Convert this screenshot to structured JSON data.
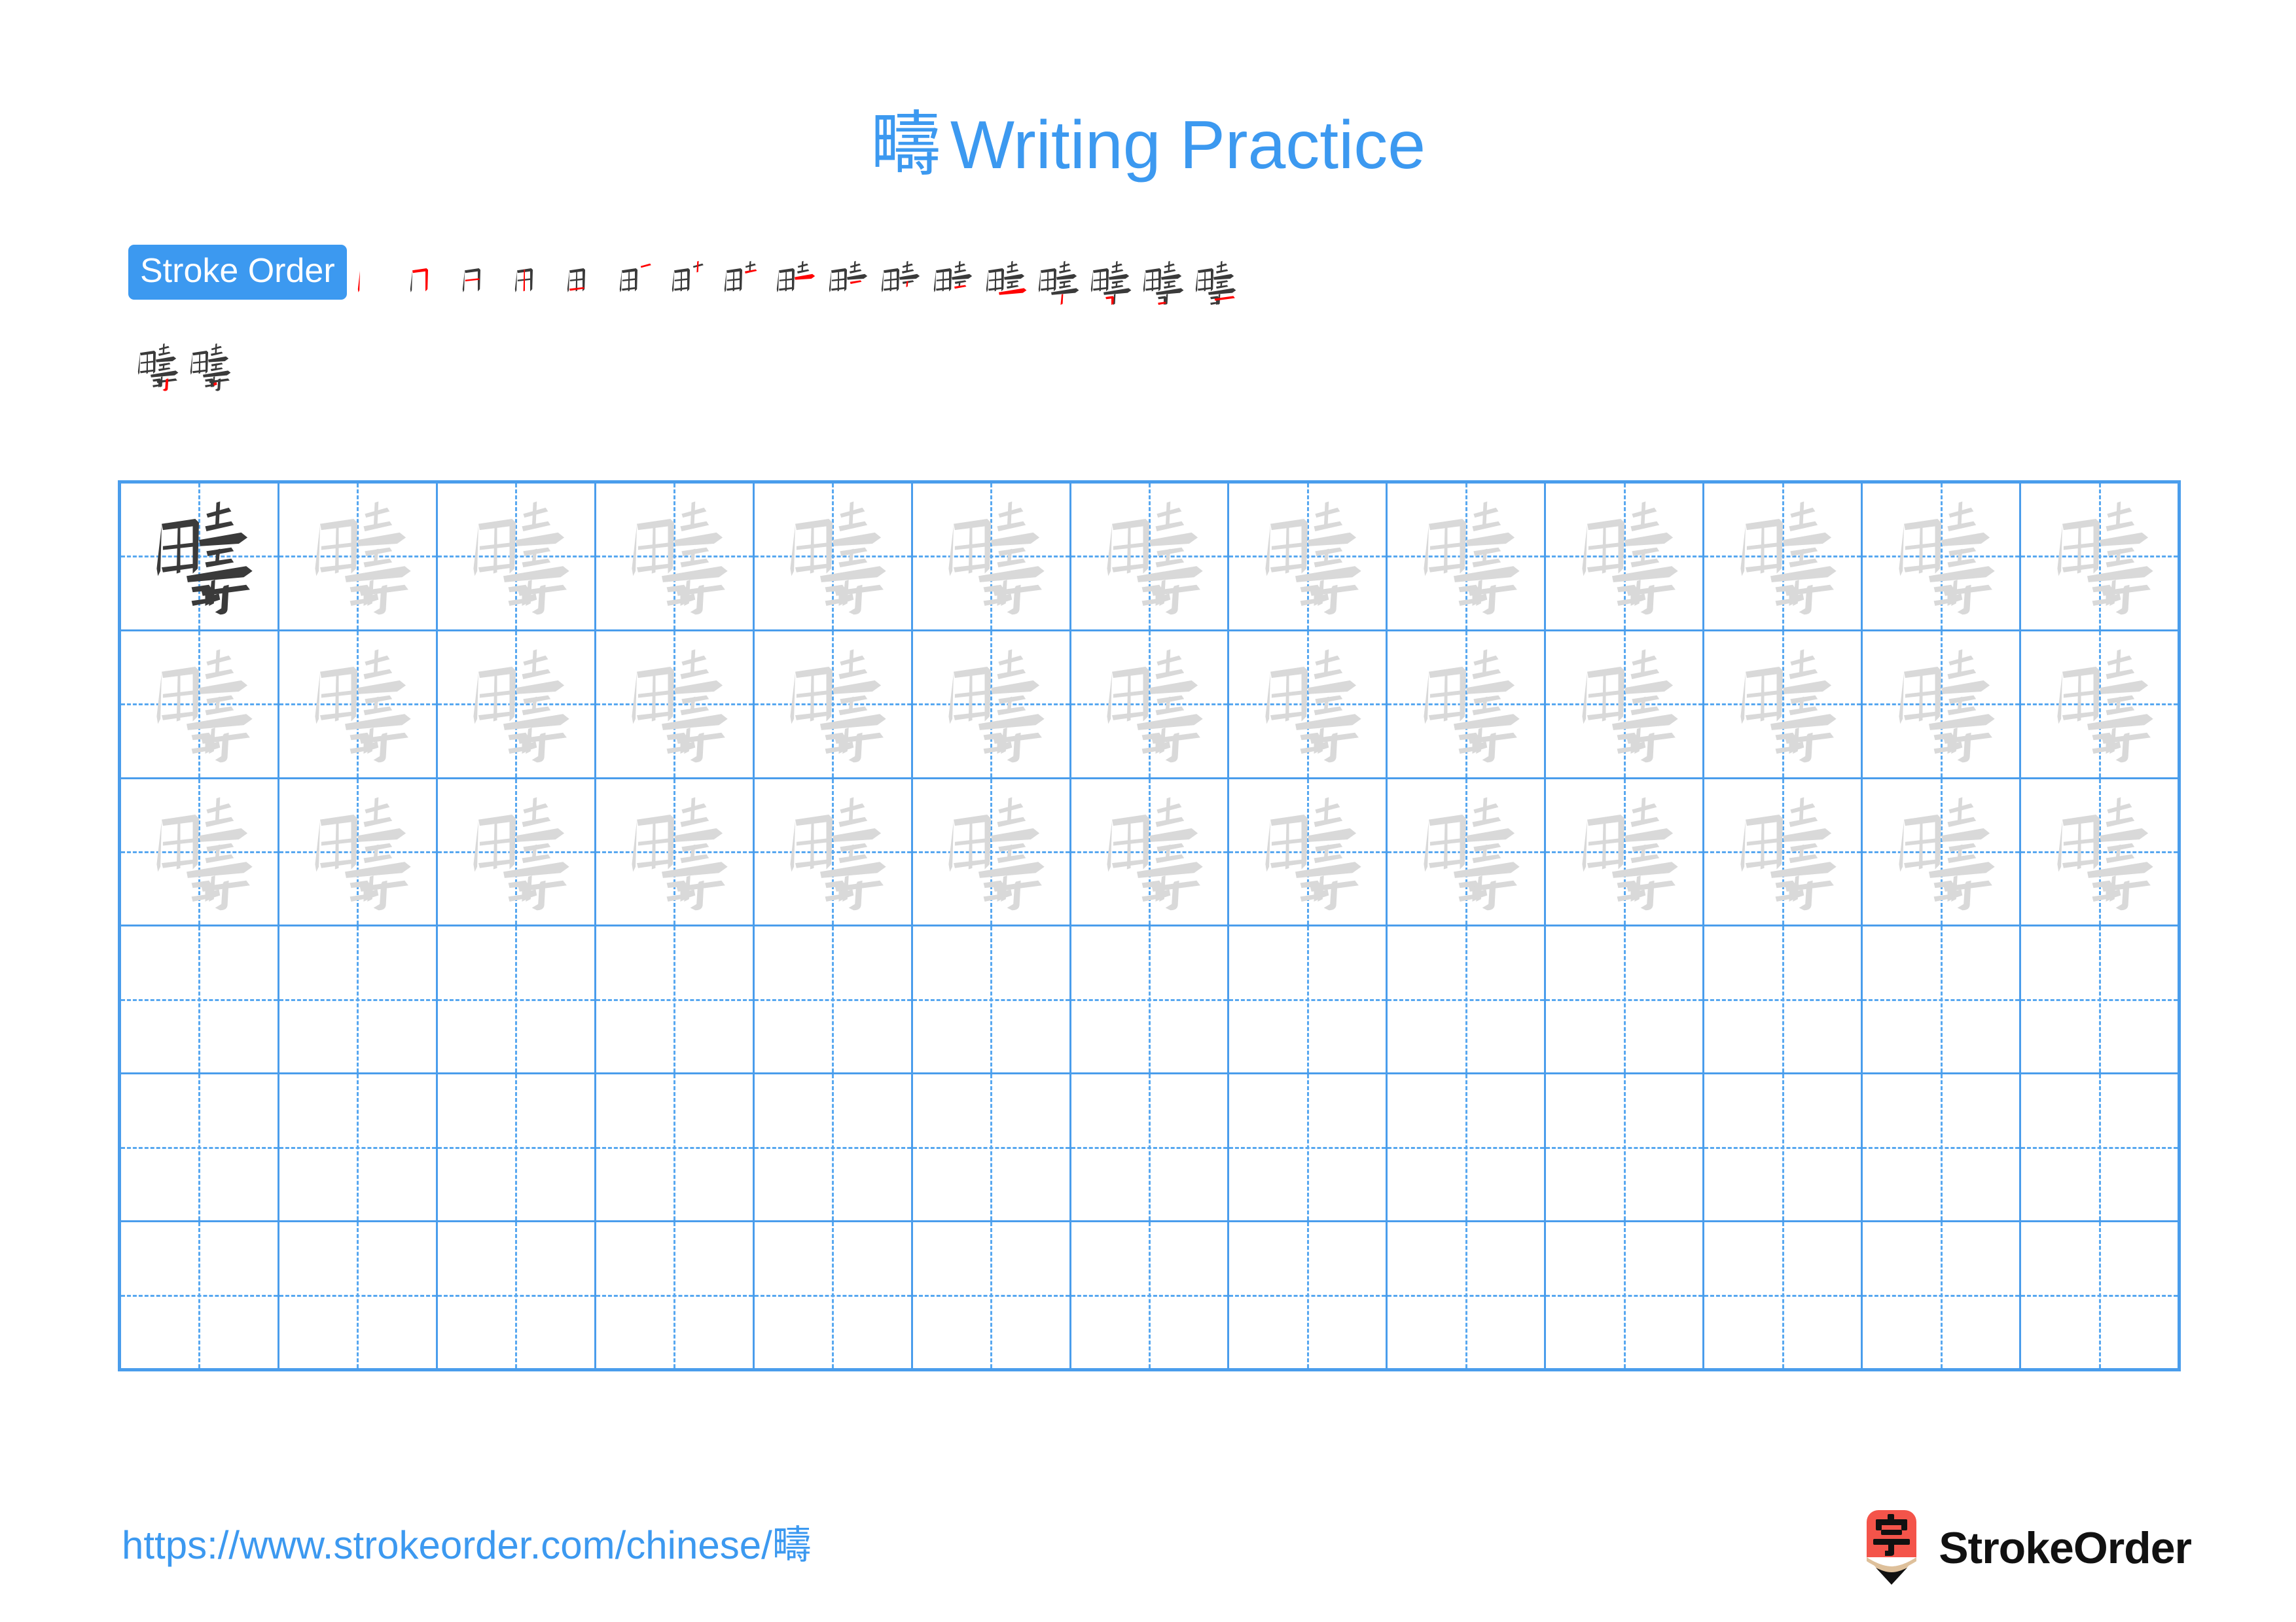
{
  "page": {
    "character": "疇",
    "title_char": "疇",
    "title_text": "Writing Practice",
    "accent_color": "#3C99F0",
    "grid_line_color": "#4A9DEC",
    "trace_color": "#D9D9D9",
    "dark_char_color": "#3A3A3A",
    "stroke_highlight_color": "#FF0000"
  },
  "stroke_order": {
    "badge_label": "Stroke Order",
    "total_strokes": 19,
    "row1_count": 17,
    "row2_count": 2,
    "steps": [
      {
        "index": 1,
        "partial": "丨"
      },
      {
        "index": 2,
        "partial": "冂"
      },
      {
        "index": 3,
        "partial": "日"
      },
      {
        "index": 4,
        "partial": "由"
      },
      {
        "index": 5,
        "partial": "田"
      },
      {
        "index": 6,
        "partial": "田一"
      },
      {
        "index": 7,
        "partial": "田十"
      },
      {
        "index": 8,
        "partial": "田士"
      },
      {
        "index": 9,
        "partial": "畦"
      },
      {
        "index": 10,
        "partial": "畦"
      },
      {
        "index": 11,
        "partial": "畴"
      },
      {
        "index": 12,
        "partial": "畴"
      },
      {
        "index": 13,
        "partial": "疇"
      },
      {
        "index": 14,
        "partial": "疇"
      },
      {
        "index": 15,
        "partial": "疇"
      },
      {
        "index": 16,
        "partial": "疇"
      },
      {
        "index": 17,
        "partial": "疇"
      },
      {
        "index": 18,
        "partial": "疇"
      },
      {
        "index": 19,
        "partial": "疇"
      }
    ]
  },
  "practice_grid": {
    "columns": 13,
    "rows": 6,
    "traced_rows": 3,
    "blank_rows": 3,
    "first_cell_style": "dark",
    "cell_character": "疇"
  },
  "footer": {
    "url_prefix": "https://www.strokeorder.com/chinese/",
    "url_char": "疇",
    "brand_name": "StrokeOrder",
    "logo_char": "字",
    "logo_body_color": "#F4544A",
    "logo_wood_color": "#DEC09B",
    "logo_tip_color": "#111111"
  }
}
